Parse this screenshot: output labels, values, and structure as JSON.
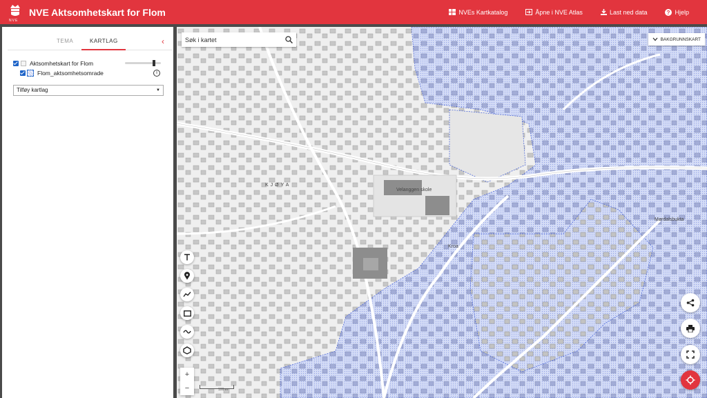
{
  "header": {
    "logo_text": "NVE",
    "title": "NVE Aktsomhetskart for Flom",
    "links": [
      {
        "label": "NVEs Kartkatalog",
        "icon": "catalog-icon"
      },
      {
        "label": "Åpne i NVE Atlas",
        "icon": "open-external-icon"
      },
      {
        "label": "Last ned data",
        "icon": "download-icon"
      },
      {
        "label": "Hjelp",
        "icon": "help-icon"
      }
    ]
  },
  "sidebar": {
    "tabs": [
      {
        "label": "TEMA",
        "active": false
      },
      {
        "label": "KARTLAG",
        "active": true
      }
    ],
    "collapse_icon": "chevron-left-icon",
    "layers": [
      {
        "label": "Aktsomhetskart for Flom",
        "checked": true,
        "opacity": 0.8
      },
      {
        "label": "Flom_aktsomhetsomrade",
        "checked": true
      }
    ],
    "add_layer_select": "Tilføy kartlag"
  },
  "map": {
    "search_placeholder": "Søk i kartet",
    "basemap_button": "BAKGRUNNSKART",
    "labels": [
      "KJØYA",
      "Velanggen skole",
      "Mørdalsbukta",
      "Kroa"
    ],
    "draw_tools": [
      "text-tool-icon",
      "point-tool-icon",
      "line-tool-icon",
      "rectangle-tool-icon",
      "freehand-tool-icon",
      "polygon-tool-icon"
    ],
    "zoom_in": "+",
    "zoom_out": "−",
    "scale_label": "100 m",
    "right_tools": [
      "share-icon",
      "print-icon",
      "fullscreen-icon",
      "locate-icon"
    ],
    "flood_color": "#c9d2f5",
    "accent_color": "#e2353e"
  }
}
